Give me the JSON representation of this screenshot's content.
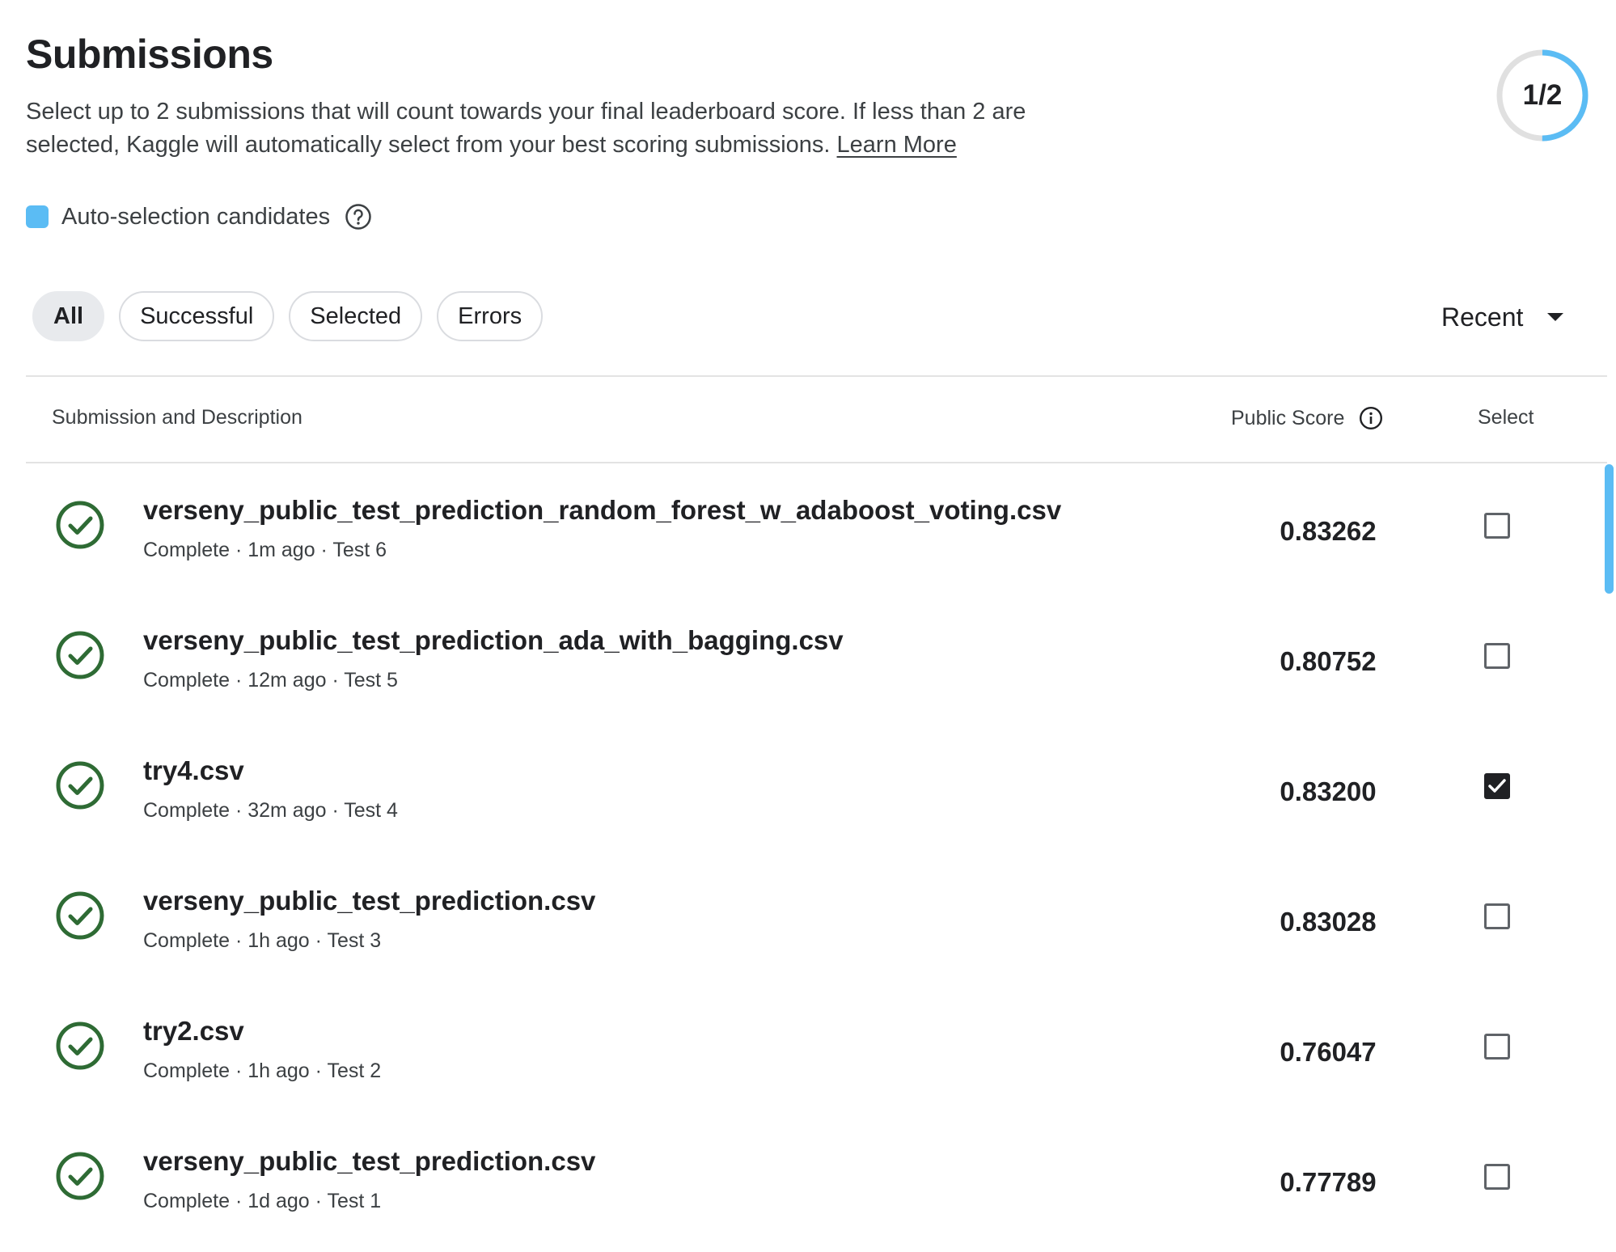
{
  "header": {
    "title": "Submissions",
    "description": "Select up to 2 submissions that will count towards your final leaderboard score. If less than 2 are selected, Kaggle will automatically select from your best scoring submissions.",
    "learn_more": "Learn More",
    "selection_counter": "1/2",
    "selected_fraction": 0.5
  },
  "legend": {
    "label": "Auto-selection candidates",
    "swatch_color": "#5bbcf4",
    "help_icon": "question-circle-icon"
  },
  "filters": {
    "items": [
      {
        "label": "All",
        "active": true
      },
      {
        "label": "Successful",
        "active": false
      },
      {
        "label": "Selected",
        "active": false
      },
      {
        "label": "Errors",
        "active": false
      }
    ]
  },
  "sort": {
    "label": "Recent",
    "icon": "caret-down-icon"
  },
  "table": {
    "columns": {
      "submission": "Submission and Description",
      "score": "Public Score",
      "select": "Select"
    },
    "rows": [
      {
        "name": "verseny_public_test_prediction_random_forest_w_adaboost_voting.csv",
        "meta": "Complete · 1m ago · Test 6",
        "score": "0.83262",
        "selected": false
      },
      {
        "name": "verseny_public_test_prediction_ada_with_bagging.csv",
        "meta": "Complete · 12m ago · Test 5",
        "score": "0.80752",
        "selected": false
      },
      {
        "name": "try4.csv",
        "meta": "Complete · 32m ago · Test 4",
        "score": "0.83200",
        "selected": true
      },
      {
        "name": "verseny_public_test_prediction.csv",
        "meta": "Complete · 1h ago · Test 3",
        "score": "0.83028",
        "selected": false
      },
      {
        "name": "try2.csv",
        "meta": "Complete · 1h ago · Test 2",
        "score": "0.76047",
        "selected": false
      },
      {
        "name": "verseny_public_test_prediction.csv",
        "meta": "Complete · 1d ago · Test 1",
        "score": "0.77789",
        "selected": false
      }
    ]
  },
  "colors": {
    "accent": "#5bbcf4",
    "success": "#2e6b34",
    "text": "#202124"
  }
}
